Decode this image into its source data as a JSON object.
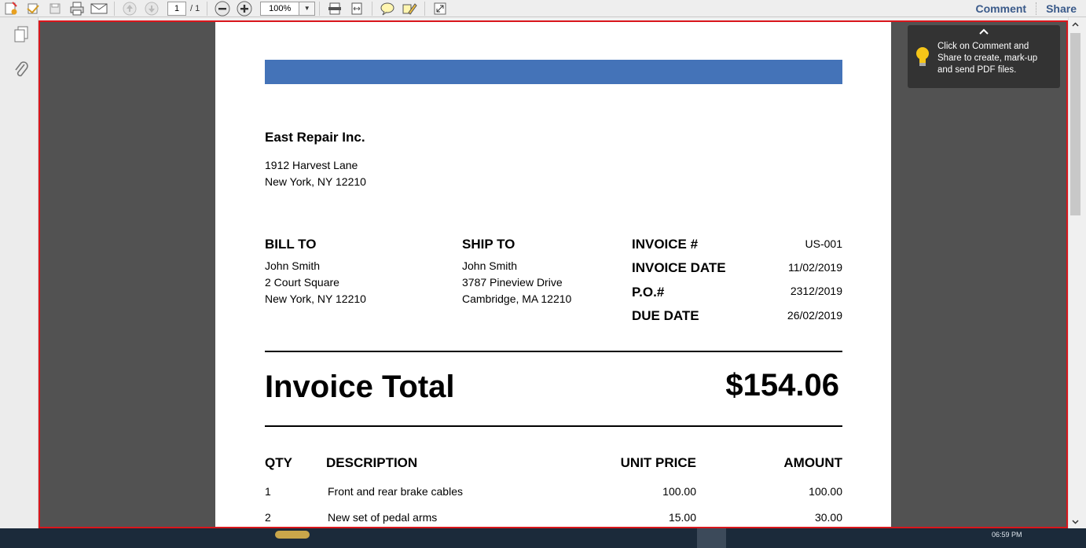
{
  "toolbar": {
    "page_current": "1",
    "page_total": "/ 1",
    "zoom": "100%",
    "comment_label": "Comment",
    "share_label": "Share",
    "icons": [
      "create-pdf-icon",
      "combine-icon",
      "save-icon",
      "print-icon",
      "email-icon",
      "previous-page-icon",
      "next-page-icon",
      "zoom-out-icon",
      "zoom-in-icon",
      "fit-page-icon",
      "fit-width-icon",
      "sticky-note-icon",
      "highlight-icon",
      "fullscreen-icon"
    ]
  },
  "sidebar": {
    "icons": [
      "page-thumbnails-icon",
      "attachments-icon"
    ]
  },
  "tooltip": {
    "text": "Click on Comment and Share to create, mark-up and send PDF files."
  },
  "invoice": {
    "accent_color": "#4473b8",
    "company": "East Repair Inc.",
    "company_address": [
      "1912 Harvest Lane",
      "New York, NY 12210"
    ],
    "bill_to": {
      "heading": "BILL TO",
      "lines": [
        "John Smith",
        "2 Court Square",
        "New York, NY 12210"
      ]
    },
    "ship_to": {
      "heading": "SHIP TO",
      "lines": [
        "John Smith",
        "3787 Pineview Drive",
        "Cambridge, MA 12210"
      ]
    },
    "meta": [
      {
        "label": "INVOICE #",
        "value": "US-001"
      },
      {
        "label": "INVOICE DATE",
        "value": "11/02/2019"
      },
      {
        "label": "P.O.#",
        "value": "2312/2019"
      },
      {
        "label": "DUE DATE",
        "value": "26/02/2019"
      }
    ],
    "total_label": "Invoice Total",
    "total_value": "$154.06",
    "table": {
      "headers": {
        "qty": "QTY",
        "description": "DESCRIPTION",
        "unit_price": "UNIT PRICE",
        "amount": "AMOUNT"
      },
      "rows": [
        {
          "qty": "1",
          "description": "Front and rear brake cables",
          "unit_price": "100.00",
          "amount": "100.00"
        },
        {
          "qty": "2",
          "description": "New set of pedal arms",
          "unit_price": "15.00",
          "amount": "30.00"
        }
      ]
    }
  },
  "taskbar": {
    "clock": "06:59 PM"
  }
}
